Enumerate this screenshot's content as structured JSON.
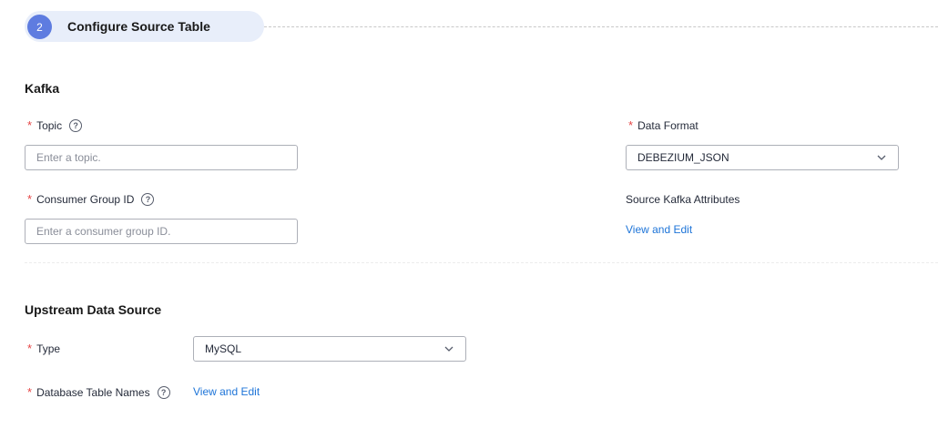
{
  "step": {
    "number": "2",
    "title": "Configure Source Table"
  },
  "kafka": {
    "section_title": "Kafka",
    "topic": {
      "label": "Topic",
      "placeholder": "Enter a topic."
    },
    "consumer_group": {
      "label": "Consumer Group ID",
      "placeholder": "Enter a consumer group ID."
    },
    "data_format": {
      "label": "Data Format",
      "value": "DEBEZIUM_JSON"
    },
    "attributes": {
      "label": "Source Kafka Attributes",
      "link": "View and Edit"
    }
  },
  "upstream": {
    "section_title": "Upstream Data Source",
    "type": {
      "label": "Type",
      "value": "MySQL"
    },
    "table_names": {
      "label": "Database Table Names",
      "link": "View and Edit"
    }
  },
  "colors": {
    "accent": "#5e7ce0",
    "link": "#1d74d8",
    "required": "#e54545",
    "pill_bg": "#e8eefa"
  }
}
